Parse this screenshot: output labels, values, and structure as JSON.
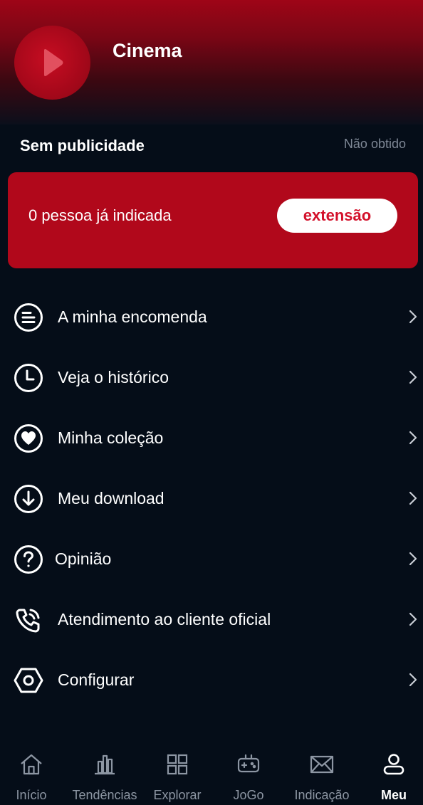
{
  "app": {
    "title": "Cinema",
    "logo_icon": "play-icon",
    "accent": "#b1081b"
  },
  "no_ads": {
    "title": "Sem publicidade",
    "status": "Não obtido"
  },
  "invite": {
    "text": "0 pessoa já indicada",
    "button": "extensão"
  },
  "menu": [
    {
      "label": "A minha encomenda",
      "icon": "order-list-icon"
    },
    {
      "label": "Veja o histórico",
      "icon": "clock-icon"
    },
    {
      "label": "Minha coleção",
      "icon": "heart-icon"
    },
    {
      "label": "Meu download",
      "icon": "download-icon"
    },
    {
      "label": "Opinião",
      "icon": "help-icon"
    },
    {
      "label": "Atendimento ao cliente oficial",
      "icon": "phone-icon"
    },
    {
      "label": "Configurar",
      "icon": "settings-hexagon-icon"
    }
  ],
  "nav": [
    {
      "label": "Início",
      "icon": "home-icon",
      "active": false
    },
    {
      "label": "Tendências",
      "icon": "trends-icon",
      "active": false
    },
    {
      "label": "Explorar",
      "icon": "grid-icon",
      "active": false
    },
    {
      "label": "JoGo",
      "icon": "gamepad-icon",
      "active": false
    },
    {
      "label": "Indicação",
      "icon": "mail-icon",
      "active": false
    },
    {
      "label": "Meu",
      "icon": "user-icon",
      "active": true
    }
  ]
}
